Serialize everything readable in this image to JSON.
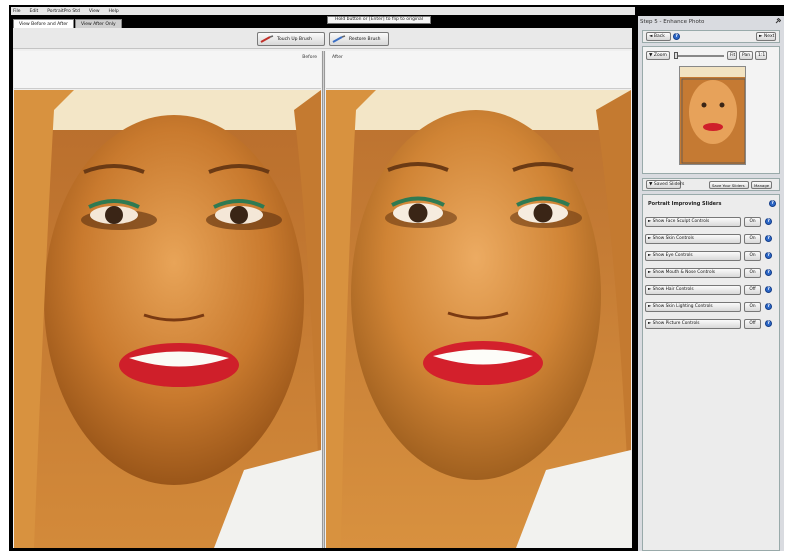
{
  "menu": [
    "File",
    "Edit",
    "PortraitPro Std",
    "View",
    "Help"
  ],
  "hint": "Hold button or [Enter] to flip to original",
  "tabs": [
    {
      "label": "View Before and After",
      "active": true
    },
    {
      "label": "View After Only",
      "active": false
    }
  ],
  "toolbar": {
    "touchup_label": "Touch Up Brush",
    "restore_label": "Restore Brush"
  },
  "panels": {
    "before_label": "Before",
    "after_label": "After"
  },
  "side": {
    "title": "Step 5 - Enhance Photo",
    "back_label": "◄ Back",
    "next_label": "► Next",
    "zoom_label": "▼ Zoom",
    "fit_label": "Fit",
    "pan_label": "Pan",
    "one_label": "1:1",
    "saved_label": "▼ Saved Sliders",
    "save_filter_label": "Save Your Sliders",
    "manage_label": "Manage",
    "sliders_title": "Portrait Improving Sliders",
    "rows": [
      {
        "label": "► Show Face Sculpt Controls",
        "state": "On"
      },
      {
        "label": "► Show Skin Controls",
        "state": "On"
      },
      {
        "label": "► Show Eye Controls",
        "state": "On"
      },
      {
        "label": "► Show Mouth & Nose Controls",
        "state": "On"
      },
      {
        "label": "► Show Hair Controls",
        "state": "Off"
      },
      {
        "label": "► Show Skin Lighting Controls",
        "state": "On"
      },
      {
        "label": "► Show Picture Controls",
        "state": "Off"
      }
    ]
  },
  "colors": {
    "accent": "#2d69c9",
    "background": "#d9dbe0"
  },
  "icons": [
    "touch-up-brush-icon",
    "restore-brush-icon",
    "help-icon",
    "pin-icon"
  ]
}
